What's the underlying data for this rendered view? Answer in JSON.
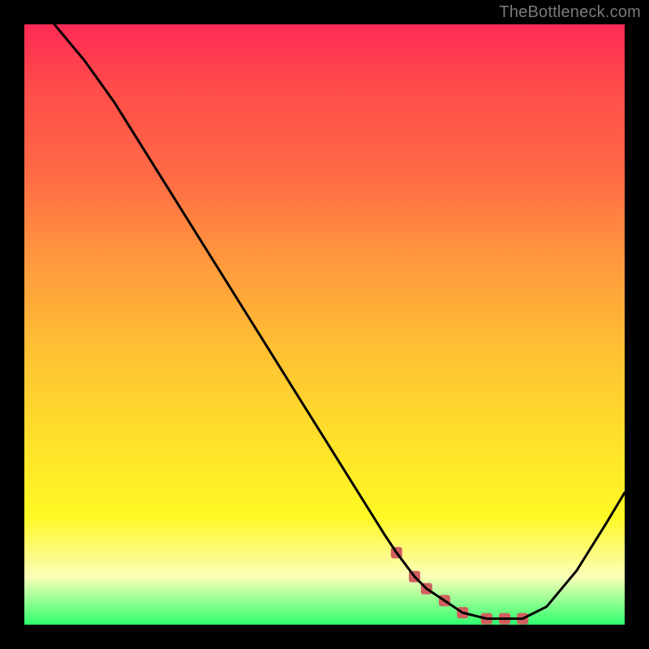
{
  "watermark": "TheBottleneck.com",
  "chart_data": {
    "type": "line",
    "title": "",
    "xlabel": "",
    "ylabel": "",
    "xlim": [
      0,
      100
    ],
    "ylim": [
      0,
      100
    ],
    "grid": false,
    "legend": false,
    "series": [
      {
        "name": "curve",
        "color": "#000000",
        "x": [
          5,
          10,
          15,
          20,
          25,
          30,
          35,
          40,
          45,
          50,
          55,
          60,
          62,
          65,
          67,
          70,
          73,
          77,
          80,
          83,
          87,
          92,
          97,
          100
        ],
        "y": [
          100,
          94,
          87,
          79,
          71,
          63,
          55,
          47,
          39,
          31,
          23,
          15,
          12,
          8,
          6,
          4,
          2,
          1,
          1,
          1,
          3,
          9,
          17,
          22
        ]
      }
    ],
    "markers": {
      "name": "trough-highlight",
      "color": "#d0605e",
      "x": [
        62,
        65,
        67,
        70,
        73,
        77,
        80,
        83
      ],
      "y": [
        12,
        8,
        6,
        4,
        2,
        1,
        1,
        1
      ]
    }
  }
}
